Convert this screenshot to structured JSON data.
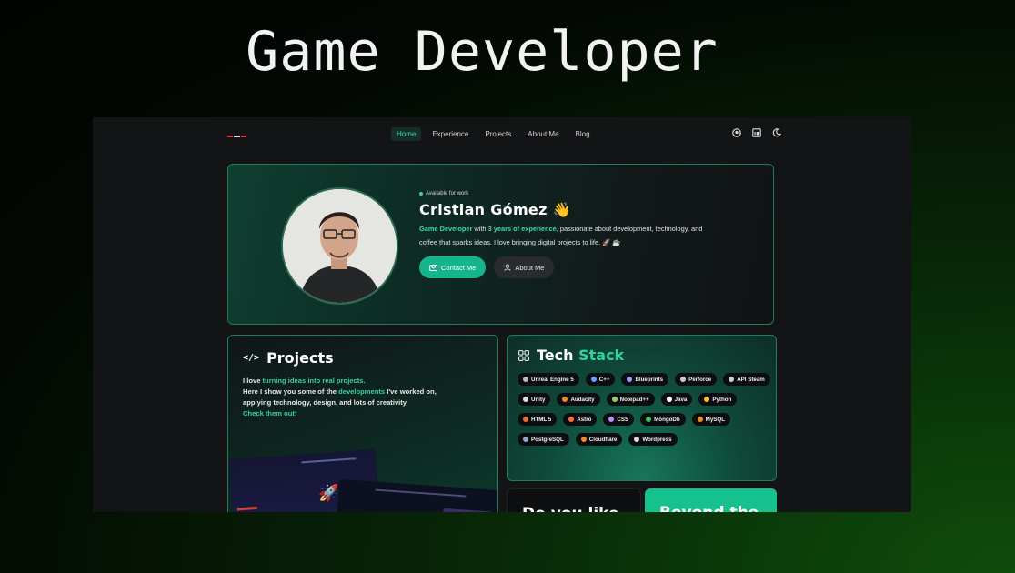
{
  "heading": "Game Developer",
  "nav": {
    "links": [
      "Home",
      "Experience",
      "Projects",
      "About Me",
      "Blog"
    ],
    "active": "Home",
    "icons": [
      "github-icon",
      "linkedin-icon",
      "theme-toggle-icon"
    ]
  },
  "hero": {
    "availability": "Available for work",
    "name": "Cristian Gómez 👋",
    "bio_role": "Game Developer",
    "bio_with": " with ",
    "bio_experience": "3 years of experience",
    "bio_rest": ", passionate about development, technology, and coffee that sparks ideas. I love bringing digital projects to life. 🚀 ☕",
    "contact_label": "Contact Me",
    "about_label": "About Me"
  },
  "projects": {
    "title": "Projects",
    "line1_prefix": "I love ",
    "line1_highlight": "turning ideas into real projects.",
    "line2_prefix": "Here I show you some of the ",
    "line2_highlight": "developments",
    "line2_rest": " I've worked on, applying technology, design, and lots of creativity.",
    "cta": "Check them out!"
  },
  "tech_stack": {
    "title_a": "Tech",
    "title_b": "Stack",
    "items": [
      {
        "label": "Unreal Engine 5",
        "icon": "unreal-icon",
        "color": "#bbbbbb"
      },
      {
        "label": "C++",
        "icon": "cpp-icon",
        "color": "#6aa0ff"
      },
      {
        "label": "Blueprints",
        "icon": "blueprints-icon",
        "color": "#9aa3ff"
      },
      {
        "label": "Perforce",
        "icon": "perforce-icon",
        "color": "#cccccc"
      },
      {
        "label": "API Steam",
        "icon": "steam-icon",
        "color": "#d0d0d0"
      },
      {
        "label": "Unity",
        "icon": "unity-icon",
        "color": "#dddddd"
      },
      {
        "label": "Audacity",
        "icon": "audacity-icon",
        "color": "#f08a2a"
      },
      {
        "label": "Notepad++",
        "icon": "notepad-icon",
        "color": "#8fd06a"
      },
      {
        "label": "Java",
        "icon": "java-icon",
        "color": "#ffffff"
      },
      {
        "label": "Python",
        "icon": "python-icon",
        "color": "#f2c230"
      },
      {
        "label": "HTML 5",
        "icon": "html-icon",
        "color": "#e86a3a"
      },
      {
        "label": "Astro",
        "icon": "astro-icon",
        "color": "#ff6a3a"
      },
      {
        "label": "CSS",
        "icon": "css-icon",
        "color": "#b98cff"
      },
      {
        "label": "MongoDb",
        "icon": "mongodb-icon",
        "color": "#3fbf5a"
      },
      {
        "label": "MySQL",
        "icon": "mysql-icon",
        "color": "#e48f2f"
      },
      {
        "label": "PostgreSQL",
        "icon": "postgresql-icon",
        "color": "#8aa8d0"
      },
      {
        "label": "Cloudflare",
        "icon": "cloudflare-icon",
        "color": "#f28a2a"
      },
      {
        "label": "Wordpress",
        "icon": "wordpress-icon",
        "color": "#dddddd"
      }
    ]
  },
  "bottom_cards": {
    "likes_text": "Do you like",
    "beyond_text": "Beyond the"
  }
}
